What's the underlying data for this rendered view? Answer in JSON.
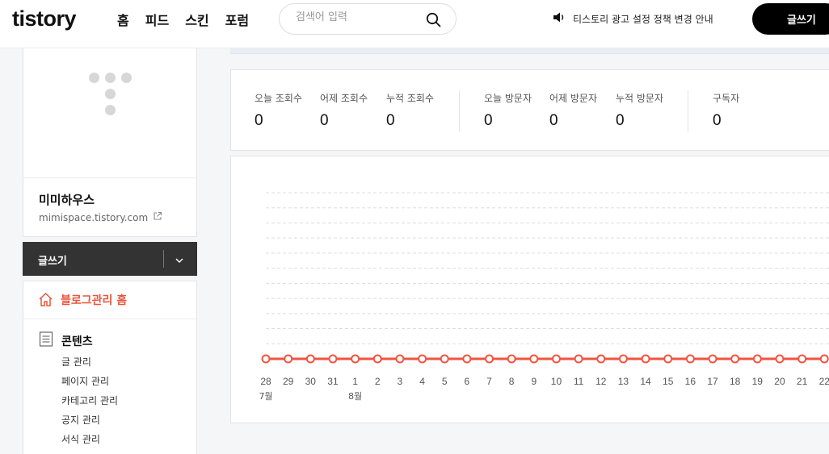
{
  "header": {
    "logo": "tistory",
    "nav": [
      "홈",
      "피드",
      "스킨",
      "포럼"
    ],
    "search": {
      "placeholder": "검색어 입력",
      "value": ""
    },
    "notice": "티스토리 광고 설정 정책 변경 안내",
    "write_label": "글쓰기"
  },
  "sidebar": {
    "blog_name": "미미하우스",
    "blog_url": "mimispace.tistory.com",
    "write_label": "글쓰기",
    "home_label": "블로그관리 홈",
    "section_title": "콘텐츠",
    "items": [
      "글 관리",
      "페이지 관리",
      "카테고리 관리",
      "공지 관리",
      "서식 관리"
    ]
  },
  "stats": [
    {
      "label": "오늘 조회수",
      "value": "0"
    },
    {
      "label": "어제 조회수",
      "value": "0"
    },
    {
      "label": "누적 조회수",
      "value": "0"
    },
    {
      "label": "오늘 방문자",
      "value": "0"
    },
    {
      "label": "어제 방문자",
      "value": "0"
    },
    {
      "label": "누적 방문자",
      "value": "0"
    },
    {
      "label": "구독자",
      "value": "0"
    }
  ],
  "chart_data": {
    "type": "line",
    "x": [
      "28",
      "29",
      "30",
      "31",
      "1",
      "2",
      "3",
      "4",
      "5",
      "6",
      "7",
      "8",
      "9",
      "10",
      "11",
      "12",
      "13",
      "14",
      "15",
      "16",
      "17",
      "18",
      "19",
      "20",
      "21",
      "22"
    ],
    "month_labels": [
      {
        "at": "28",
        "label": "7월"
      },
      {
        "at": "1",
        "label": "8월"
      }
    ],
    "series": [
      {
        "values": [
          0,
          0,
          0,
          0,
          0,
          0,
          0,
          0,
          0,
          0,
          0,
          0,
          0,
          0,
          0,
          0,
          0,
          0,
          0,
          0,
          0,
          0,
          0,
          0,
          0,
          0
        ]
      }
    ],
    "grid": true,
    "colors": {
      "line": "#ef5440",
      "grid": "#dddddd"
    }
  }
}
